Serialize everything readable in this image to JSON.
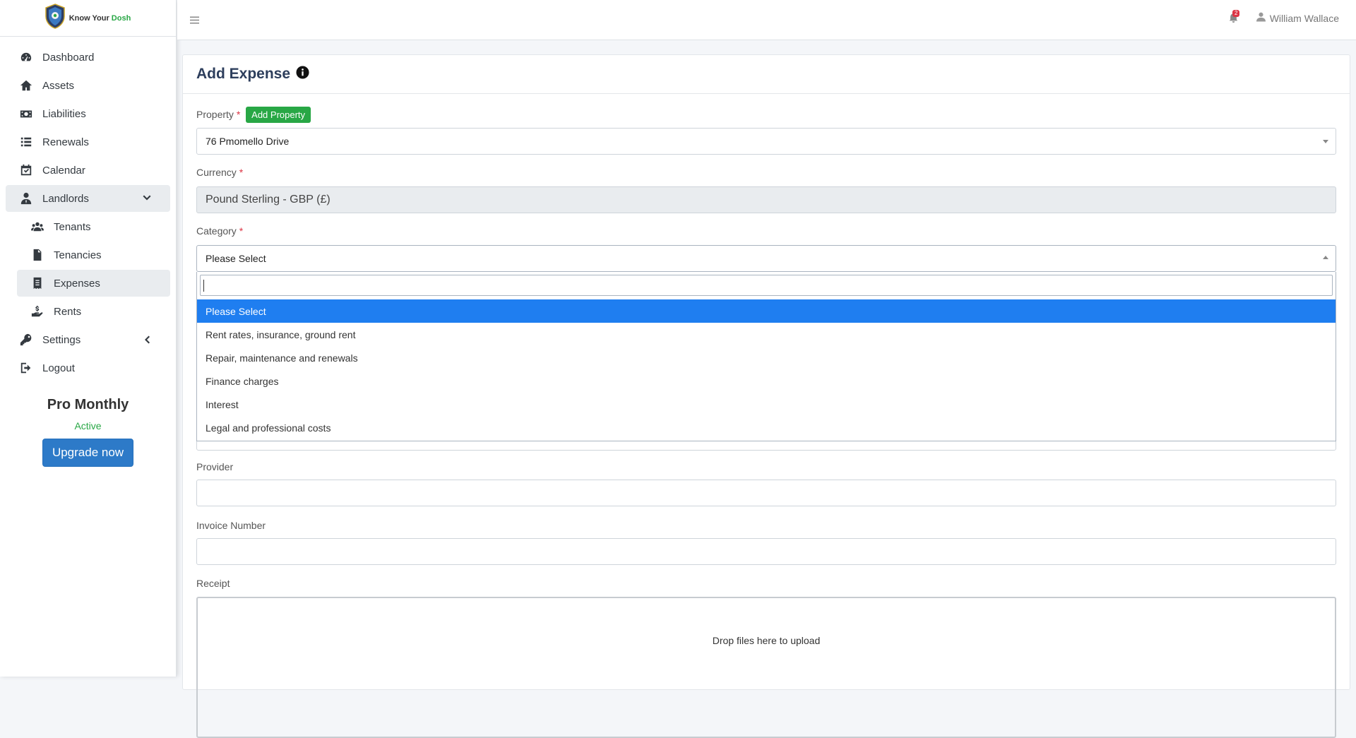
{
  "brand": {
    "name_part1": "Know Your ",
    "name_part2": "Dosh",
    "accent": "#28a745"
  },
  "sidebar": {
    "items": [
      {
        "label": "Dashboard",
        "icon": "gauge-icon"
      },
      {
        "label": "Assets",
        "icon": "home-icon"
      },
      {
        "label": "Liabilities",
        "icon": "money-bill-icon"
      },
      {
        "label": "Renewals",
        "icon": "list-icon"
      },
      {
        "label": "Calendar",
        "icon": "calendar-check-icon"
      },
      {
        "label": "Landlords",
        "icon": "user-tie-icon",
        "expanded": true
      },
      {
        "label": "Tenants",
        "icon": "users-icon"
      },
      {
        "label": "Tenancies",
        "icon": "file-contract-icon"
      },
      {
        "label": "Expenses",
        "icon": "receipt-icon",
        "active": true
      },
      {
        "label": "Rents",
        "icon": "hand-holding-dollar-icon"
      },
      {
        "label": "Settings",
        "icon": "key-icon"
      },
      {
        "label": "Logout",
        "icon": "sign-out-icon"
      }
    ]
  },
  "plan": {
    "name": "Pro Monthly",
    "status": "Active",
    "upgrade_label": "Upgrade now"
  },
  "topbar": {
    "notification_count": "2",
    "user_name": "William Wallace"
  },
  "page": {
    "title": "Add Expense",
    "property": {
      "label": "Property",
      "add_label": "Add Property",
      "value": "76 Pmomello Drive"
    },
    "currency": {
      "label": "Currency",
      "value": "Pound Sterling - GBP (£)"
    },
    "category": {
      "label": "Category",
      "value": "Please Select",
      "options": [
        "Please Select",
        "Rent rates, insurance, ground rent",
        "Repair, maintenance and renewals",
        "Finance charges",
        "Interest",
        "Legal and professional costs"
      ]
    },
    "provider": {
      "label": "Provider"
    },
    "invoice": {
      "label": "Invoice Number"
    },
    "receipt": {
      "label": "Receipt",
      "dropzone_text": "Drop files here to upload"
    },
    "required_mark": "*"
  },
  "colors": {
    "primary": "#2d7ac8",
    "success": "#28a745",
    "danger": "#dc3545",
    "selected": "#1f7ef0"
  }
}
